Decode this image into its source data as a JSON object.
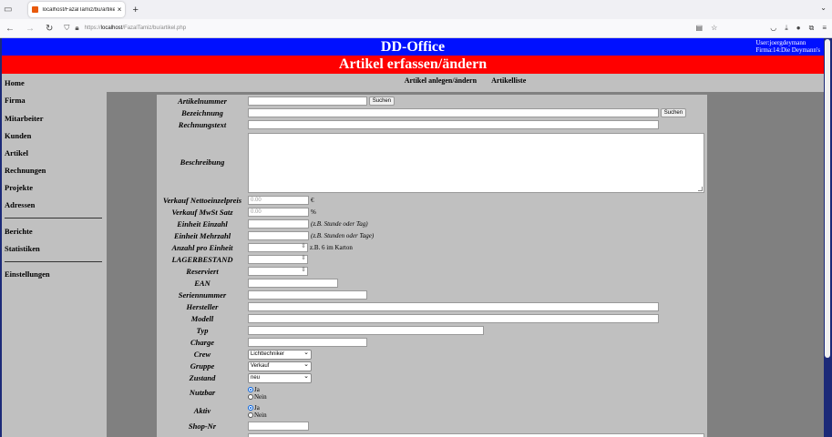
{
  "browser": {
    "tab_title": "localhost/FazalTamiz/bu/artikel",
    "tab_close": "×",
    "new_tab": "+",
    "url_prefix": "https://",
    "url_host": "localhost",
    "url_path": "/FazalTamiz/bu/artikel.php"
  },
  "app": {
    "title": "DD-Office",
    "user_line": "User:joergdeymann",
    "firma_line": "Firma:14:Die Deymann's",
    "page_heading": "Artikel erfassen/ändern"
  },
  "sidebar": {
    "items": [
      "Home",
      "Firma",
      "Mitarbeiter",
      "Kunden",
      "Artikel",
      "Rechnungen",
      "Projekte",
      "Adressen",
      "Berichte",
      "Statistiken",
      "Einstellungen"
    ]
  },
  "tabs": [
    "Artikel anlegen/ändern",
    "Artikelliste"
  ],
  "form": {
    "labels": {
      "artikelnummer": "Artikelnummer",
      "bezeichnung": "Bezeichnung",
      "rechnungstext": "Rechnungstext",
      "beschreibung": "Beschreibung",
      "vk_netto": "Verkauf Nettoeinzelpreis",
      "vk_mwst": "Verkauf MwSt Satz",
      "einheit_einzahl": "Einheit Einzahl",
      "einheit_mehrzahl": "Einheit Mehrzahl",
      "anzahl_pro_einheit": "Anzahl pro Einheit",
      "lagerbestand": "LAGERBESTAND",
      "reserviert": "Reserviert",
      "ean": "EAN",
      "seriennummer": "Seriennummer",
      "hersteller": "Hersteller",
      "modell": "Modell",
      "typ": "Typ",
      "charge": "Charge",
      "crew": "Crew",
      "gruppe": "Gruppe",
      "zustand": "Zustand",
      "nutzbar": "Nutzbar",
      "aktiv": "Aktiv",
      "shop_nr": "Shop-Nr"
    },
    "search_button": "Suchen",
    "vk_netto_placeholder": "0.00",
    "vk_mwst_placeholder": "0.00",
    "euro_unit": "€",
    "percent_unit": "%",
    "hint_einzahl": "(z.B. Stunde oder Tag)",
    "hint_mehrzahl": "(z.B. Stunden oder Tage)",
    "hint_anzahl": "z.B. 6 im Karton",
    "crew_value": "Lichttechniker",
    "gruppe_value": "Verkauf",
    "zustand_value": "neu",
    "nutzbar_options": [
      "Ja",
      "Nein"
    ],
    "aktiv_options": [
      "Ja",
      "Nein"
    ]
  }
}
